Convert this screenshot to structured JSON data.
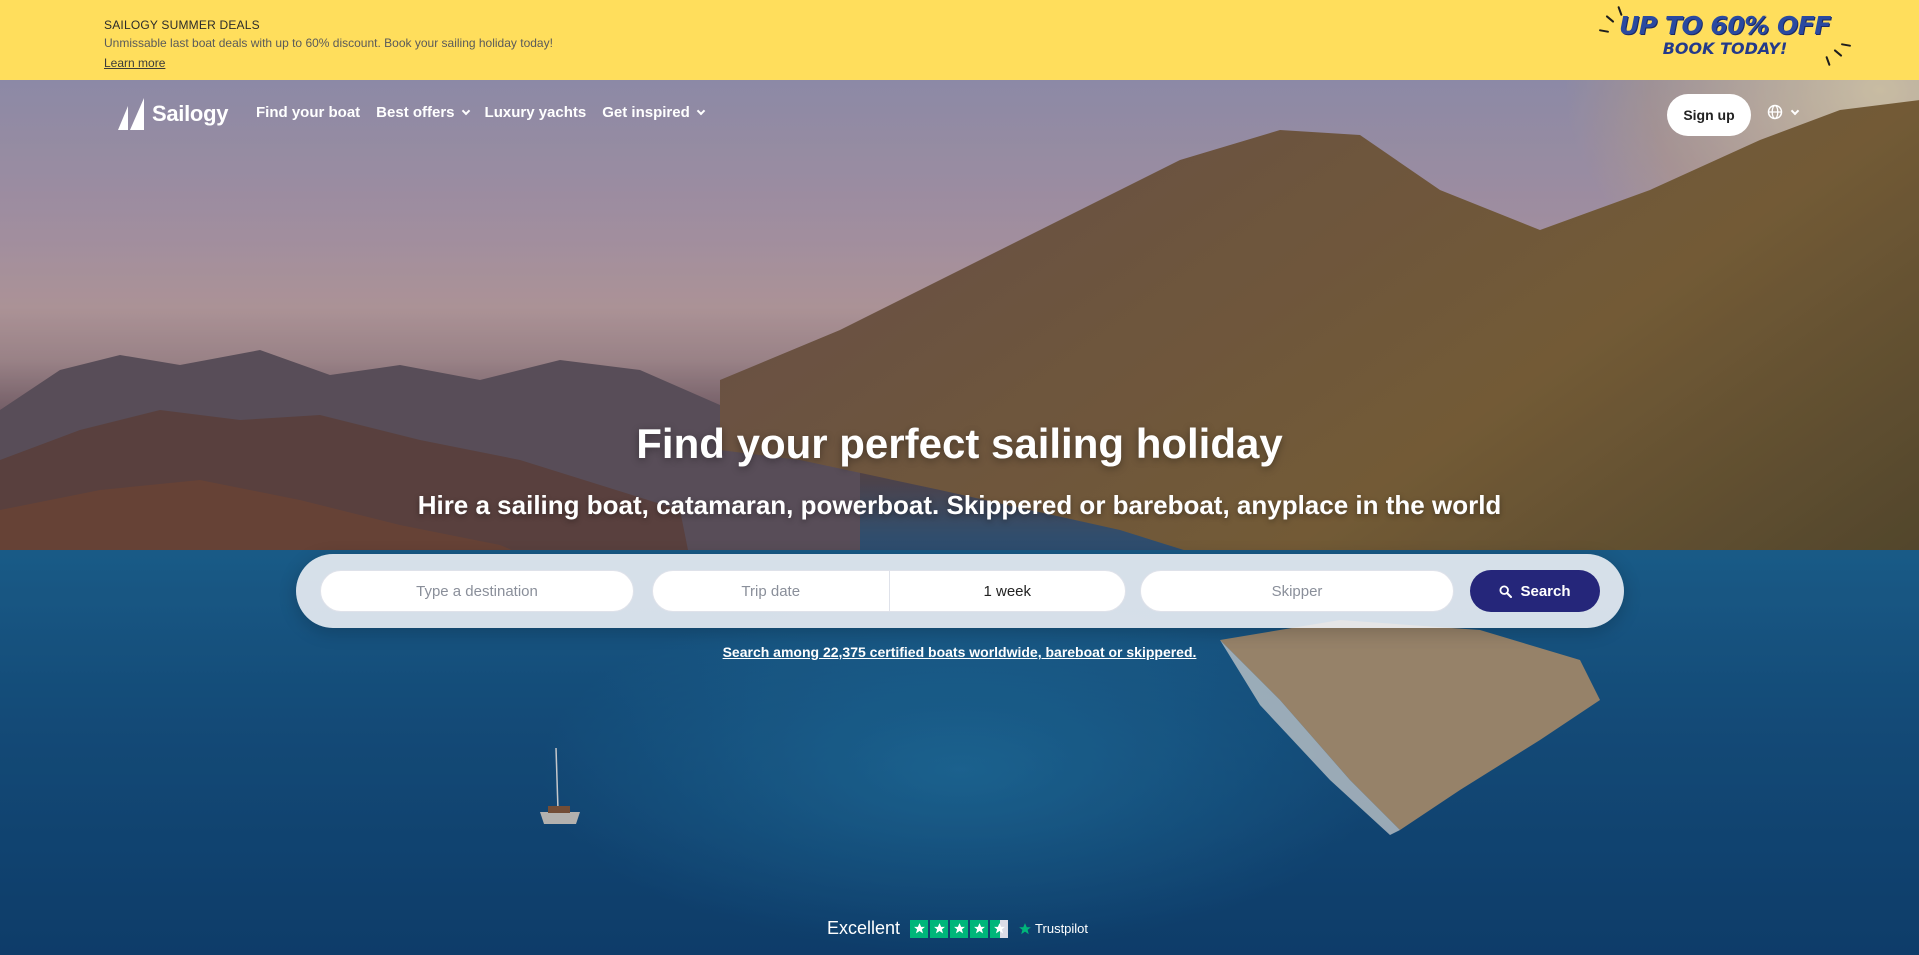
{
  "promo": {
    "title": "SAILOGY SUMMER DEALS",
    "description": "Unmissable last boat deals with up to 60% discount. Book your sailing holiday today!",
    "link": "Learn more",
    "badge_line1": "UP TO 60% OFF",
    "badge_line2": "BOOK TODAY!"
  },
  "nav": {
    "logo": "Sailogy",
    "items": [
      {
        "label": "Find your boat",
        "dropdown": false
      },
      {
        "label": "Best offers",
        "dropdown": true
      },
      {
        "label": "Luxury yachts",
        "dropdown": false
      },
      {
        "label": "Get inspired",
        "dropdown": true
      }
    ],
    "signup": "Sign up",
    "language_icon": "globe-icon"
  },
  "hero": {
    "title": "Find your perfect sailing holiday",
    "subtitle": "Hire a sailing boat, catamaran, powerboat. Skippered or bareboat, anyplace in the world"
  },
  "search": {
    "destination_placeholder": "Type a destination",
    "date_placeholder": "Trip date",
    "duration_value": "1 week",
    "skipper_placeholder": "Skipper",
    "button_label": "Search",
    "boats_link": "Search among 22,375 certified boats worldwide, bareboat or skippered."
  },
  "trustpilot": {
    "rating_word": "Excellent",
    "stars": 4.5,
    "brand": "Trustpilot"
  },
  "colors": {
    "banner": "#ffde5c",
    "search_button": "#25267a",
    "trustpilot_green": "#00b67a"
  }
}
